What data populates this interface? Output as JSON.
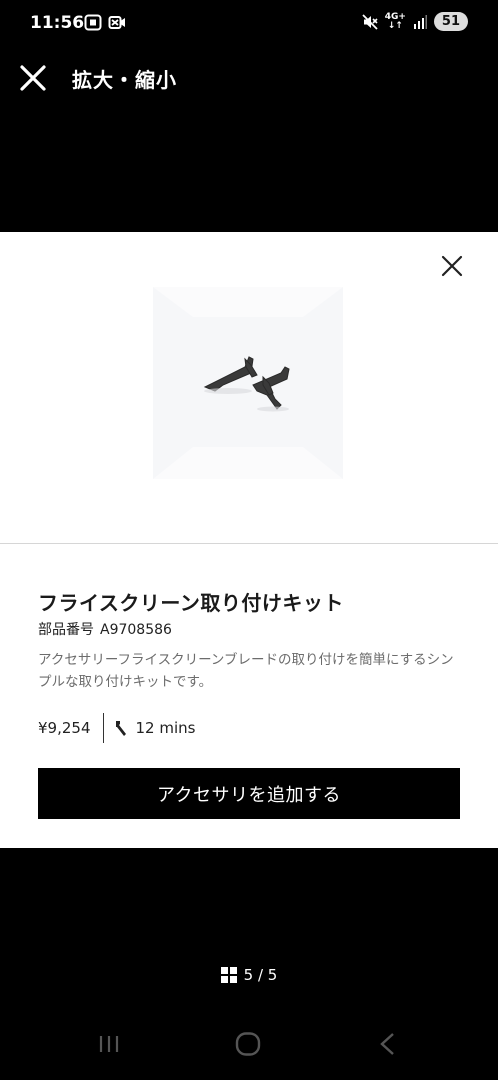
{
  "status": {
    "time": "11:56",
    "network": "4G+",
    "battery": "51"
  },
  "header": {
    "title": "拡大・縮小"
  },
  "product": {
    "title": "フライスクリーン取り付けキット",
    "part_label": "部品番号",
    "part_number": "A9708586",
    "description": "アクセサリーフライスクリーンブレードの取り付けを簡単にするシンプルな取り付けキットです。",
    "price": "¥9,254",
    "install_time": "12 mins",
    "add_button_label": "アクセサリを追加する"
  },
  "pager": {
    "label": "5 / 5"
  },
  "icons": {
    "close": "close-icon",
    "wrench": "wrench-icon",
    "grid": "grid-icon",
    "nav_recents": "recents-icon",
    "nav_home": "home-icon",
    "nav_back": "back-icon"
  }
}
